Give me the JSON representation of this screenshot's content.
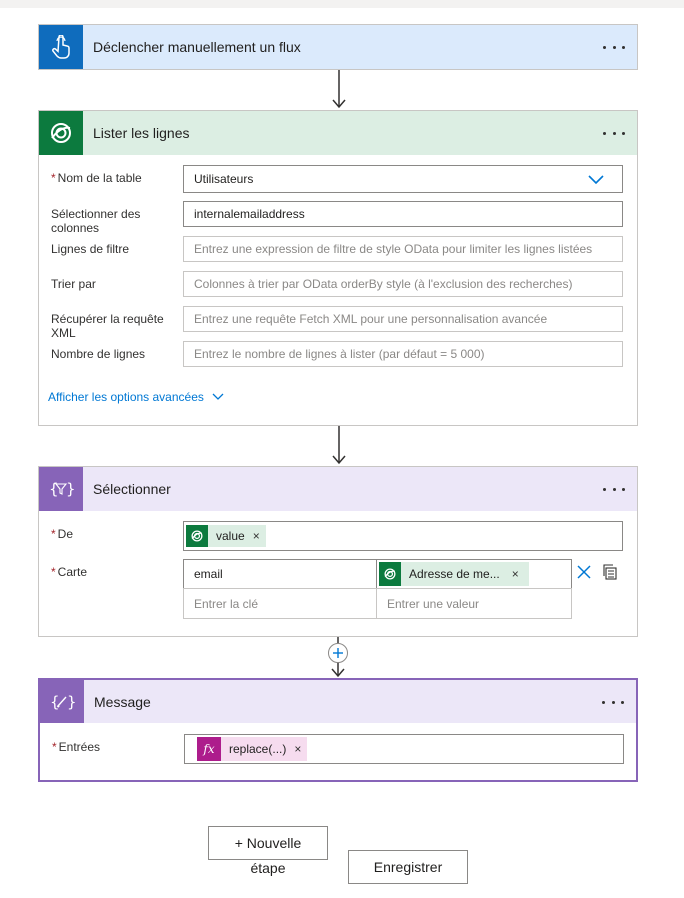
{
  "trigger": {
    "title": "Déclencher manuellement un flux"
  },
  "list_rows": {
    "title": "Lister les lignes",
    "fields": [
      {
        "label": "Nom de la table",
        "required": "*",
        "value": "Utilisateurs",
        "placeholder": ""
      },
      {
        "label": "Sélectionner des colonnes",
        "required": "",
        "value": "internalemailaddress",
        "placeholder": ""
      },
      {
        "label": "Lignes de filtre",
        "required": "",
        "value": "",
        "placeholder": "Entrez une expression de filtre de style OData pour limiter les lignes listées"
      },
      {
        "label": "Trier par",
        "required": "",
        "value": "",
        "placeholder": "Colonnes à trier par OData orderBy style (à l'exclusion des recherches)"
      },
      {
        "label": "Récupérer la requête XML",
        "required": "",
        "value": "",
        "placeholder": "Entrez une requête Fetch XML pour une personnalisation avancée"
      },
      {
        "label": "Nombre de lignes",
        "required": "",
        "value": "",
        "placeholder": "Entrez le nombre de lignes à lister (par défaut = 5 000)"
      }
    ],
    "advanced_link": "Afficher les options avancées"
  },
  "select": {
    "title": "Sélectionner",
    "from_label": "De",
    "from_token": "value",
    "map_label": "Carte",
    "required": "*",
    "map_key": "email",
    "map_value_token": "Adresse de me...",
    "key_placeholder": "Entrer la clé",
    "value_placeholder": "Entrer une valeur"
  },
  "message": {
    "title": "Message",
    "inputs_label": "Entrées",
    "required": "*",
    "token": "replace(...)"
  },
  "footer": {
    "new_step_line1": "+ Nouvelle",
    "new_step_line2": "étape",
    "save": "Enregistrer"
  },
  "colors": {
    "trigger_header": "#dbeafc",
    "trigger_icon": "#0f6cbd",
    "dataverse_header": "#dceee3",
    "dataverse_icon": "#0c7a3e",
    "data_op_header": "#ece7f8",
    "data_op_icon": "#8764b8",
    "expression_token": "#ad1d8c",
    "link": "#0078d4"
  }
}
